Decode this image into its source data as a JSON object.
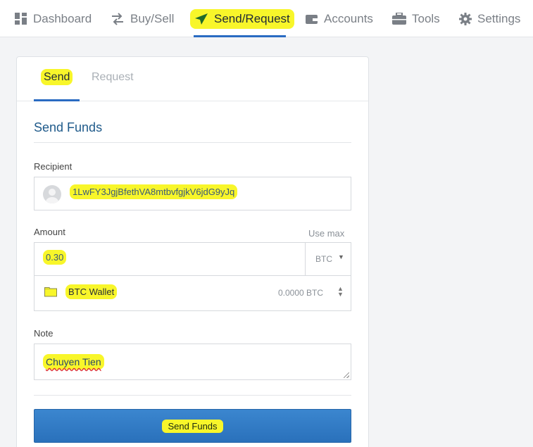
{
  "nav": {
    "items": [
      {
        "label": "Dashboard",
        "icon": "dashboard-icon"
      },
      {
        "label": "Buy/Sell",
        "icon": "swap-arrows-icon"
      },
      {
        "label": "Send/Request",
        "icon": "paper-plane-icon"
      },
      {
        "label": "Accounts",
        "icon": "wallet-icon"
      },
      {
        "label": "Tools",
        "icon": "briefcase-icon"
      },
      {
        "label": "Settings",
        "icon": "gear-icon"
      }
    ],
    "active": "Send/Request"
  },
  "tabs": {
    "send": "Send",
    "request": "Request",
    "active": "Send"
  },
  "form": {
    "title": "Send Funds",
    "recipient_label": "Recipient",
    "recipient_value": "1LwFY3JgjBfethVA8mtbvfgjkV6jdG9yJq",
    "amount_label": "Amount",
    "use_max": "Use max",
    "amount_value": "0.30",
    "currency": "BTC",
    "wallet_name": "BTC Wallet",
    "wallet_balance": "0.0000 BTC",
    "note_label": "Note",
    "note_value": "Chuyen Tien",
    "submit_label": "Send Funds"
  },
  "colors": {
    "accent": "#2a6bc2",
    "highlight": "#f8f62a",
    "title": "#1f5a8a",
    "button": "#2f7cc6"
  }
}
